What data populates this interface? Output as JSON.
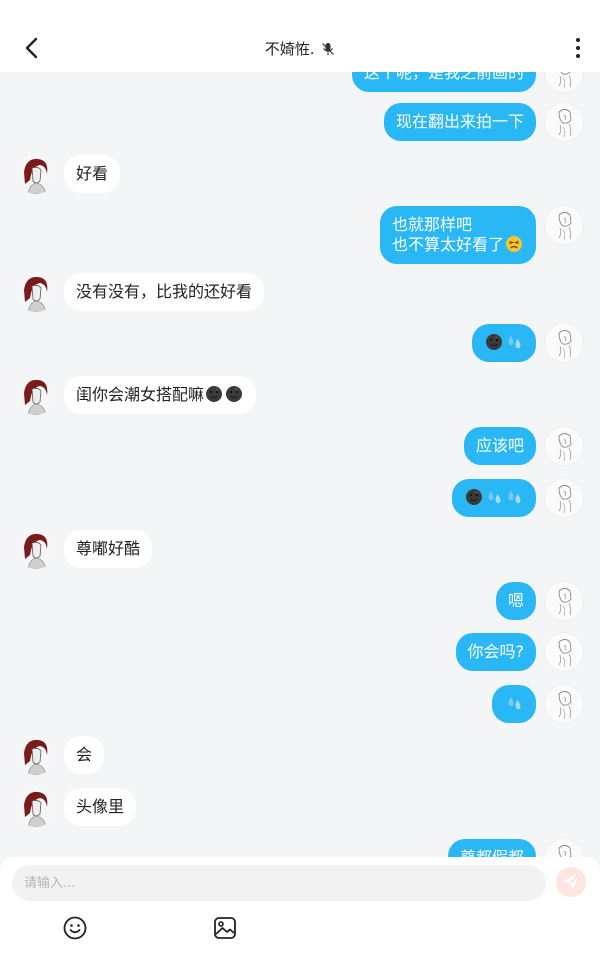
{
  "header": {
    "title": "不婍恠.",
    "mute_icon": "mic-muted-icon"
  },
  "messages": [
    {
      "dir": "out",
      "lines": [
        "这个呢，是我之前画的"
      ],
      "emojis": []
    },
    {
      "dir": "out",
      "lines": [
        "现在翻出来拍一下"
      ],
      "emojis": []
    },
    {
      "dir": "in",
      "lines": [
        "好看"
      ],
      "emojis": []
    },
    {
      "dir": "out",
      "lines": [
        "也就那样吧",
        "也不算太好看了"
      ],
      "emojis": [
        "persevering-face"
      ]
    },
    {
      "dir": "in",
      "lines": [
        "没有没有，比我的还好看"
      ],
      "emojis": []
    },
    {
      "dir": "out",
      "lines": [
        ""
      ],
      "emojis": [
        "dark-moon",
        "sweat-droplets"
      ]
    },
    {
      "dir": "in",
      "lines": [
        "闺你会潮女搭配嘛"
      ],
      "emojis": [
        "dark-moon",
        "dark-moon"
      ]
    },
    {
      "dir": "out",
      "lines": [
        "应该吧"
      ],
      "emojis": []
    },
    {
      "dir": "out",
      "lines": [
        ""
      ],
      "emojis": [
        "dark-moon",
        "sweat-droplets",
        "sweat-droplets"
      ]
    },
    {
      "dir": "in",
      "lines": [
        "尊嘟好酷"
      ],
      "emojis": []
    },
    {
      "dir": "out",
      "lines": [
        "嗯"
      ],
      "emojis": []
    },
    {
      "dir": "out",
      "lines": [
        "你会吗?"
      ],
      "emojis": []
    },
    {
      "dir": "out",
      "lines": [
        ""
      ],
      "emojis": [
        "sweat-droplets"
      ]
    },
    {
      "dir": "in",
      "lines": [
        "会"
      ],
      "emojis": []
    },
    {
      "dir": "in",
      "lines": [
        "头像里"
      ],
      "emojis": []
    },
    {
      "dir": "out",
      "lines": [
        "尊都假都"
      ],
      "emojis": []
    }
  ],
  "composer": {
    "placeholder": "请输入...",
    "value": ""
  },
  "colors": {
    "outgoing_bubble": "#2ab7f5",
    "incoming_bubble": "#ffffff",
    "background": "#f4f5f7",
    "send_button": "#ffe5df"
  }
}
